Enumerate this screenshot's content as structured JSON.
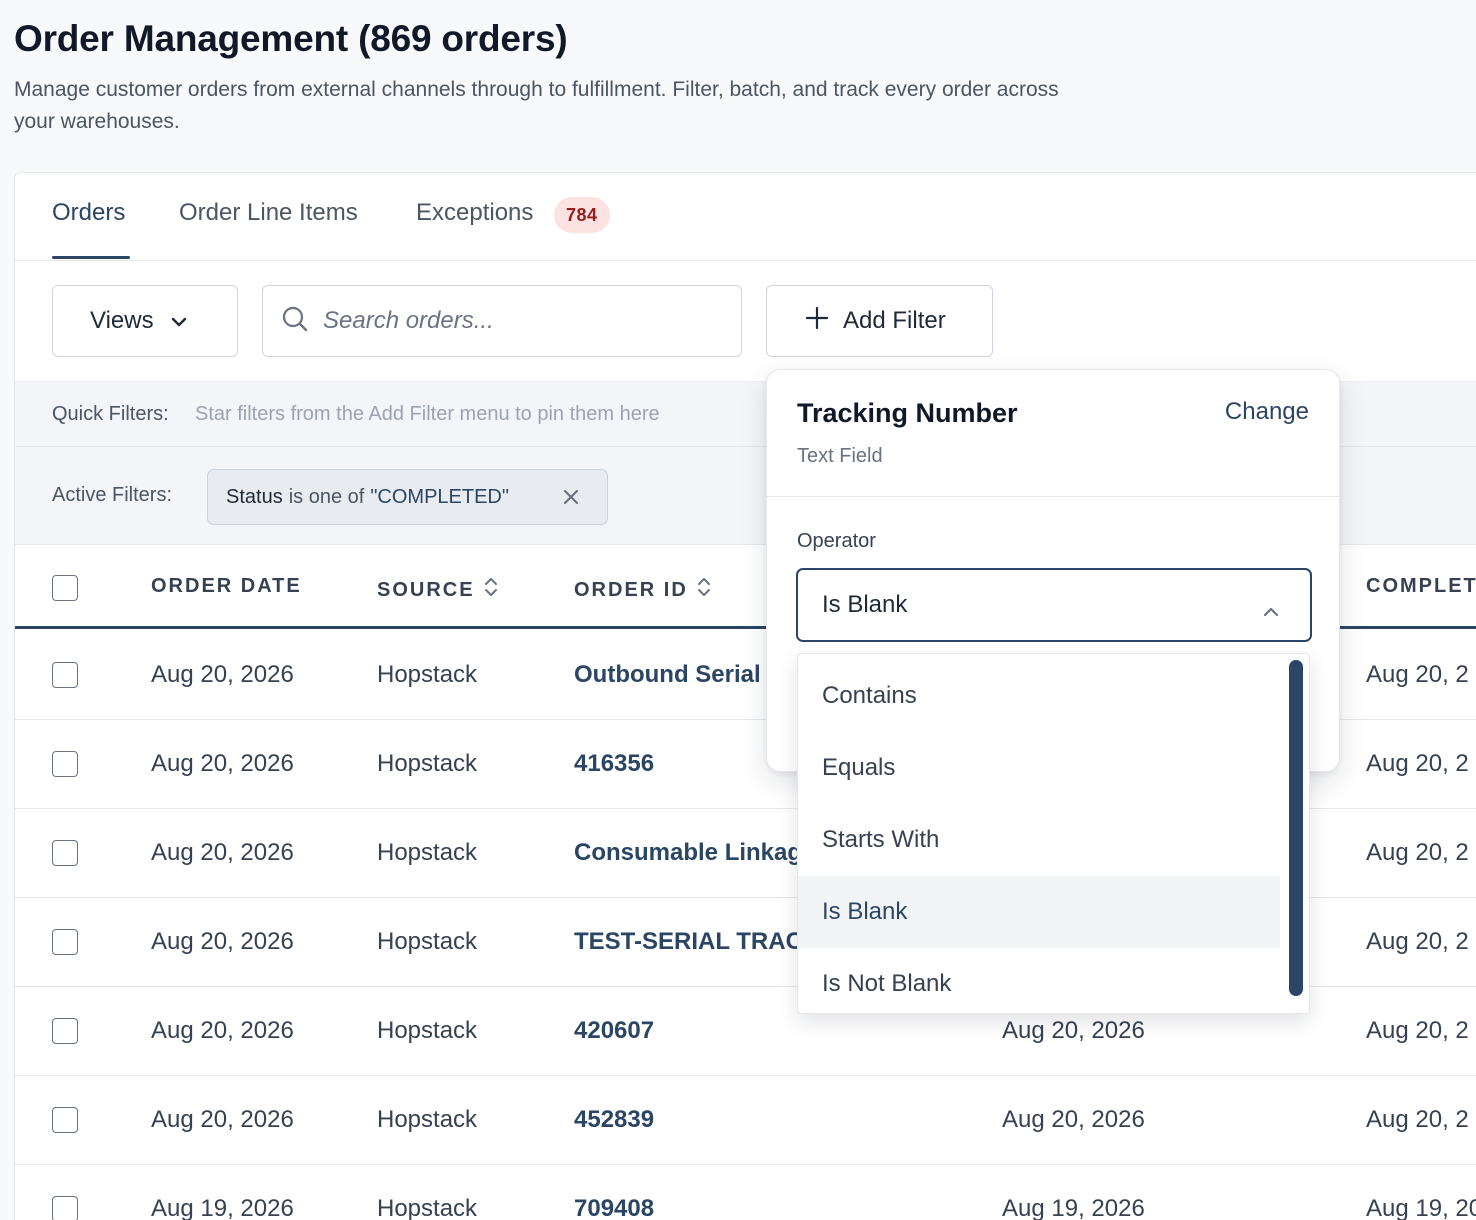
{
  "header": {
    "title": "Order Management (869 orders)",
    "description": "Manage customer orders from external channels through to fulfillment. Filter, batch, and track every order across your warehouses."
  },
  "tabs": [
    {
      "label": "Orders",
      "active": true
    },
    {
      "label": "Order Line Items",
      "active": false
    },
    {
      "label": "Exceptions",
      "active": false,
      "badge": "784"
    }
  ],
  "toolbar": {
    "views_label": "Views",
    "search_placeholder": "Search orders...",
    "add_filter_label": "Add Filter"
  },
  "quick_filters": {
    "label": "Quick Filters:",
    "hint": "Star filters from the Add Filter menu to pin them here"
  },
  "active_filters": {
    "label": "Active Filters:",
    "chip": {
      "field": "Status",
      "operator": "is one of",
      "value": "\"COMPLETED\""
    }
  },
  "table": {
    "columns": [
      "ORDER DATE",
      "SOURCE",
      "ORDER ID",
      "COMPLET"
    ],
    "rows": [
      {
        "order_date": "Aug 20, 2026",
        "source": "Hopstack",
        "order_id": "Outbound Serial",
        "date2": "",
        "completed": "Aug 20, 2"
      },
      {
        "order_date": "Aug 20, 2026",
        "source": "Hopstack",
        "order_id": "416356",
        "date2": "",
        "completed": "Aug 20, 2"
      },
      {
        "order_date": "Aug 20, 2026",
        "source": "Hopstack",
        "order_id": "Consumable Linkag",
        "date2": "",
        "completed": "Aug 20, 2"
      },
      {
        "order_date": "Aug 20, 2026",
        "source": "Hopstack",
        "order_id": "TEST-SERIAL TRAC",
        "date2": "",
        "completed": "Aug 20, 2"
      },
      {
        "order_date": "Aug 20, 2026",
        "source": "Hopstack",
        "order_id": "420607",
        "date2": "Aug 20, 2026",
        "completed": "Aug 20, 2"
      },
      {
        "order_date": "Aug 20, 2026",
        "source": "Hopstack",
        "order_id": "452839",
        "date2": "Aug 20, 2026",
        "completed": "Aug 20, 2"
      },
      {
        "order_date": "Aug 19, 2026",
        "source": "Hopstack",
        "order_id": "709408",
        "date2": "Aug 19, 2026",
        "completed": "Aug 19, 20"
      }
    ]
  },
  "filter_popover": {
    "title": "Tracking Number",
    "change_label": "Change",
    "subtitle": "Text Field",
    "operator_label": "Operator",
    "selected": "Is Blank",
    "options": [
      "Contains",
      "Equals",
      "Starts With",
      "Is Blank",
      "Is Not Blank"
    ]
  },
  "colors": {
    "accent": "#2b4564",
    "badge_bg": "#fde2e2",
    "badge_text": "#991b1b"
  }
}
